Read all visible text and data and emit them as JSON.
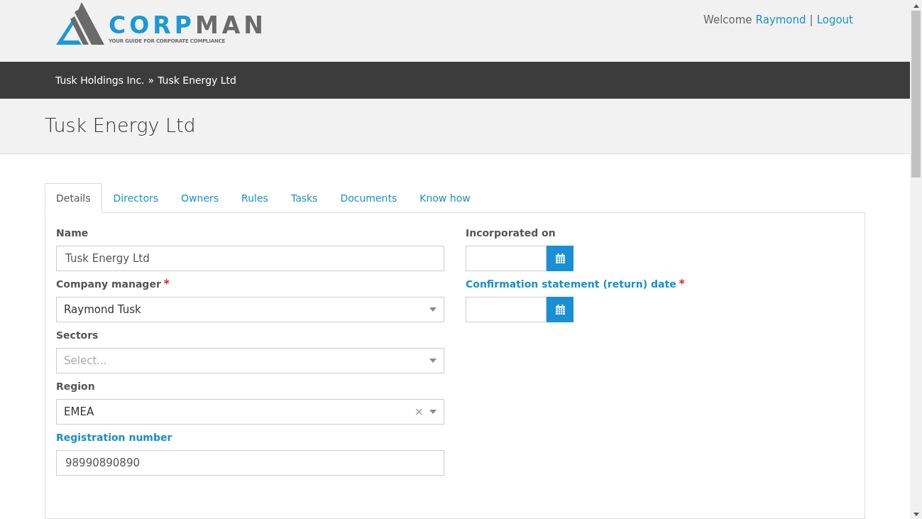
{
  "header": {
    "logo": {
      "brand_first": "CORP",
      "brand_second": "MAN",
      "tagline": "YOUR GUIDE FOR CORPORATE COMPLIANCE"
    },
    "welcome": "Welcome",
    "user": "Raymond",
    "separator": "|",
    "logout": "Logout"
  },
  "breadcrumb": {
    "items": [
      "Tusk Holdings Inc.",
      "Tusk Energy Ltd"
    ],
    "separator": "»"
  },
  "page_title": "Tusk Energy Ltd",
  "required_mark": "*",
  "tabs": [
    {
      "label": "Details",
      "selected": true
    },
    {
      "label": "Directors",
      "selected": false
    },
    {
      "label": "Owners",
      "selected": false
    },
    {
      "label": "Rules",
      "selected": false
    },
    {
      "label": "Tasks",
      "selected": false
    },
    {
      "label": "Documents",
      "selected": false
    },
    {
      "label": "Know how",
      "selected": false
    }
  ],
  "left_fields": [
    {
      "label": "Name",
      "required": false,
      "highlighted": false,
      "kind": "text",
      "value": "Tusk Energy Ltd"
    },
    {
      "label": "Company manager",
      "required": true,
      "highlighted": false,
      "kind": "select",
      "value": "Raymond Tusk"
    },
    {
      "label": "Sectors",
      "required": false,
      "highlighted": false,
      "kind": "select",
      "placeholder": "Select..."
    },
    {
      "label": "Region",
      "required": false,
      "highlighted": false,
      "kind": "select",
      "value": "EMEA",
      "clear": "×"
    },
    {
      "label": "Registration number",
      "required": false,
      "highlighted": true,
      "kind": "text",
      "value": "98990890890"
    }
  ],
  "right_fields": [
    {
      "label": "Incorporated on",
      "required": false,
      "highlighted": false,
      "kind": "date"
    },
    {
      "label": "Confirmation statement (return) date",
      "required": true,
      "highlighted": true,
      "kind": "date"
    }
  ]
}
